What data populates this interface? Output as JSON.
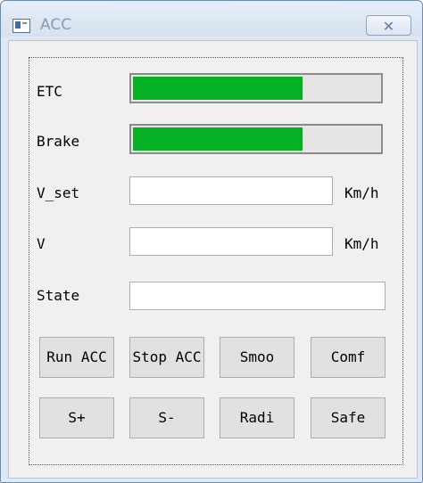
{
  "window": {
    "title": "ACC",
    "close_label": "✕"
  },
  "form": {
    "etc": {
      "label": "ETC",
      "progress": 0.69
    },
    "brake": {
      "label": "Brake",
      "progress": 0.69
    },
    "v_set": {
      "label": "V_set",
      "value": "",
      "unit": "Km/h"
    },
    "v": {
      "label": "V",
      "value": "",
      "unit": "Km/h"
    },
    "state": {
      "label": "State",
      "value": ""
    }
  },
  "buttons": {
    "run_acc": "Run ACC",
    "stop_acc": "Stop ACC",
    "smoo": "Smoo",
    "comf": "Comf",
    "s_plus": "S+",
    "s_minus": "S-",
    "radi": "Radi",
    "safe": "Safe"
  },
  "colors": {
    "progress_fill": "#06b025"
  }
}
